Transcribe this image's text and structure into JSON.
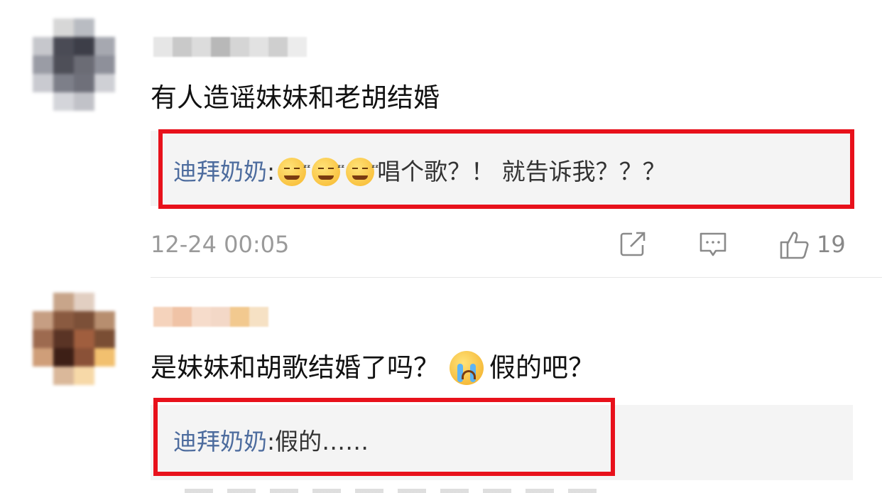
{
  "comments": [
    {
      "avatar_colors": [
        "#ffffff",
        "#d7d7d7",
        "#b9bcc2",
        "#ffffff",
        "#c6c7cc",
        "#4a4b55",
        "#3d3e48",
        "#a6a8b0",
        "#9a9ca5",
        "#4e4f58",
        "#6b6c75",
        "#8e909a",
        "#c9cad0",
        "#7d7f89",
        "#6f707a",
        "#cfd0d5",
        "#ffffff",
        "#d4d5da",
        "#c1c2c8",
        "#ffffff"
      ],
      "name_colors": [
        "#e6e6e6",
        "#c9c9c9",
        "#dcdcdc",
        "#b8b8b8",
        "#d5d5d5",
        "#e2e2e2",
        "#cfcfcf",
        "#ececec"
      ],
      "text": "有人造谣妹妹和老胡结婚",
      "reply": {
        "user": "迪拜奶奶",
        "sep": ": ",
        "after_emoji": "唱个歌？！ 就告诉我？？？",
        "emoji_count": 3,
        "emoji_name": "sleepy-emoji"
      },
      "timestamp": "12-24 00:05",
      "likes": "19"
    },
    {
      "avatar_colors": [
        "#ffffff",
        "#c8a58a",
        "#e2cfc2",
        "#ffffff",
        "#c69e83",
        "#8a5a40",
        "#7c5038",
        "#b78e6f",
        "#9d6a4f",
        "#5a3425",
        "#a05e3e",
        "#7a4e34",
        "#cf9e79",
        "#3d1f16",
        "#8a5137",
        "#f2c06f",
        "#ffffff",
        "#dab89a",
        "#f7d9a8",
        "#ffffff"
      ],
      "name_colors": [
        "#f5d3bc",
        "#f0c3a6",
        "#f6dccb",
        "#f3d8c7",
        "#f2c98f",
        "#f6e1c4"
      ],
      "text_before": "是妹妹和胡歌结婚了吗？",
      "text_after": "假的吧？",
      "emoji_name": "crying-emoji",
      "reply": {
        "user": "迪拜奶奶",
        "sep": ": ",
        "text": "假的……"
      }
    }
  ],
  "actions": {
    "share_icon": "share-icon",
    "comment_icon": "comment-icon",
    "like_icon": "thumbs-up-icon"
  },
  "colors": {
    "highlight": "#e8111b",
    "link": "#4d6c9e"
  }
}
